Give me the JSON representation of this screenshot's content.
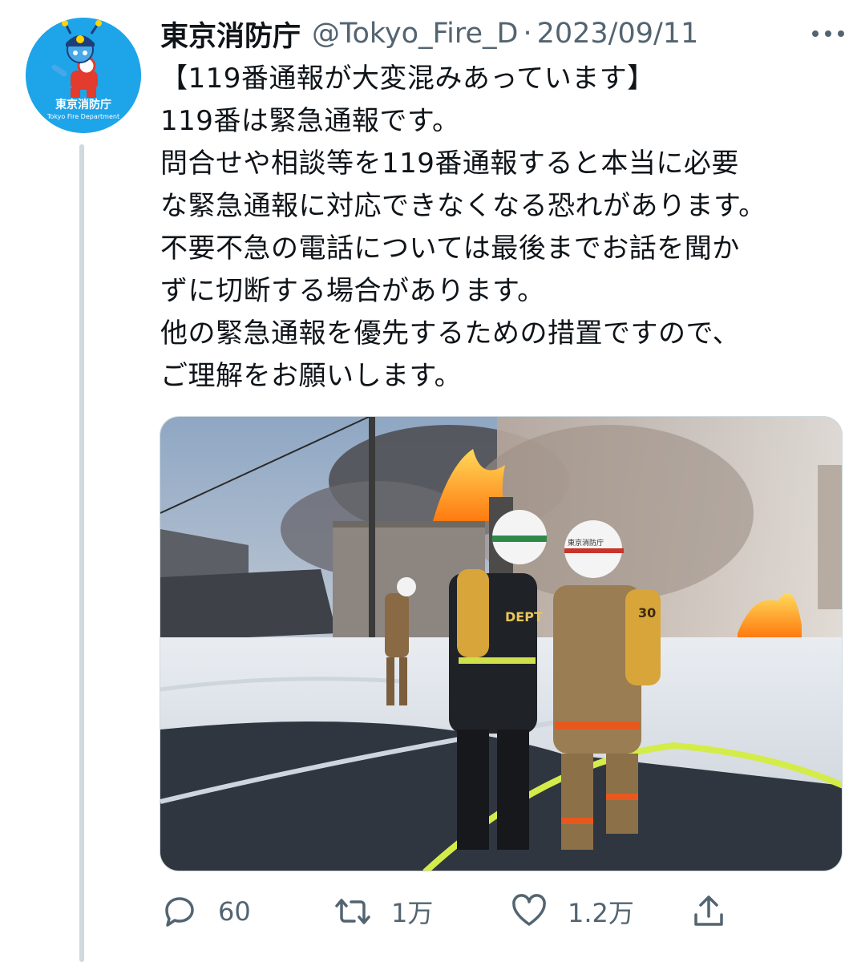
{
  "tweet": {
    "author": {
      "display_name": "東京消防庁",
      "handle": "@Tokyo_Fire_D",
      "avatar_caption": "東京消防庁",
      "avatar_subcaption": "Tokyo Fire Department"
    },
    "separator": "·",
    "date": "2023/09/11",
    "text_lines": [
      "【119番通報が大変混みあっています】",
      "119番は緊急通報です。",
      "問合せや相談等を119番通報すると本当に必要",
      "な緊急通報に対応できなくなる恐れがあります。",
      "不要不急の電話については最後までお話を聞か",
      "ずに切断する場合があります。",
      "他の緊急通報を優先するための措置ですので、",
      "ご理解をお願いします。"
    ],
    "media": {
      "description_icon": "photo",
      "helmet_text": "東京消防庁",
      "tank_number": "30",
      "jacket_text": "DEPT"
    },
    "stats": {
      "replies": "60",
      "retweets": "1万",
      "likes": "1.2万"
    }
  },
  "colors": {
    "text_primary": "#0f1419",
    "text_secondary": "#536471",
    "avatar_bg": "#1ea4e9",
    "thread_line": "#cfd9de"
  }
}
